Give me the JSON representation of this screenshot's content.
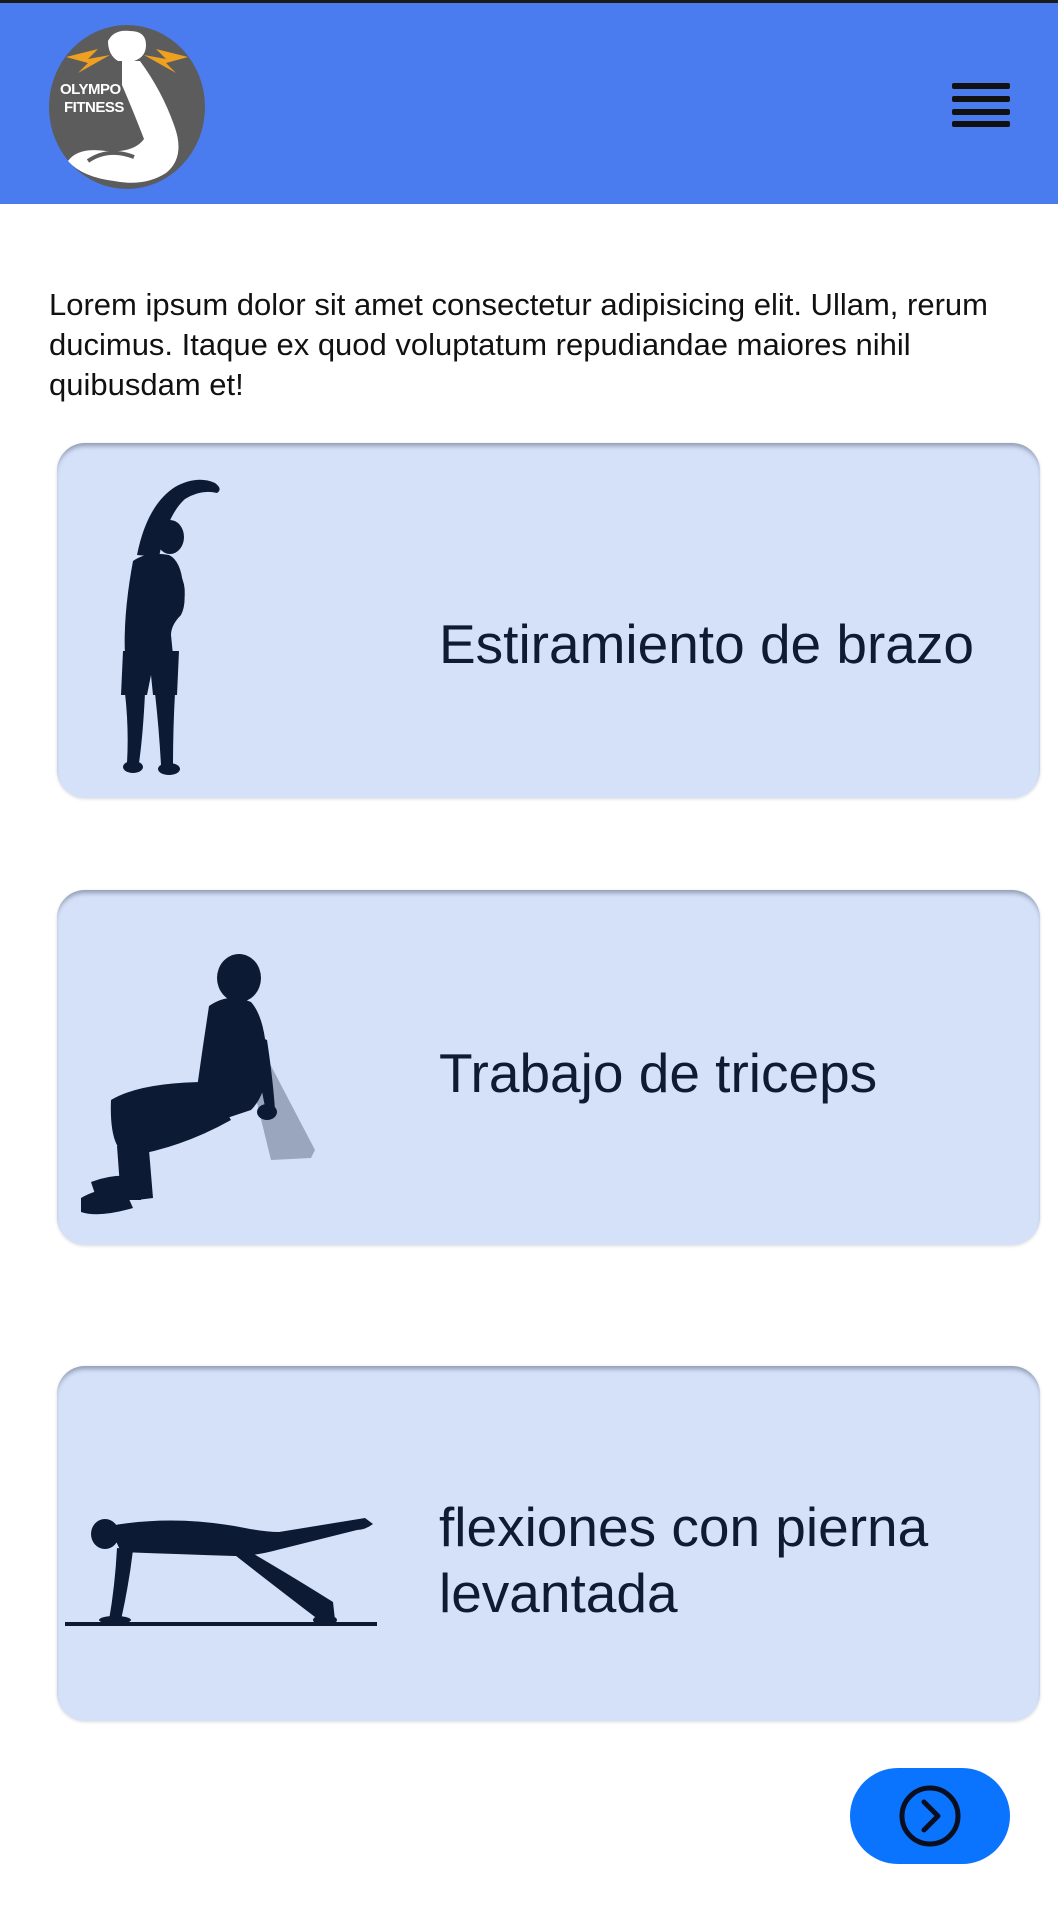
{
  "header": {
    "logo": {
      "line1": "OLYMPO",
      "line2": "FITNESS",
      "icon": "flexing-arm-lightning-logo"
    },
    "menu_icon": "hamburger-menu-icon"
  },
  "intro_text": "Lorem ipsum dolor sit amet consectetur adipisicing elit. Ullam, rerum ducimus. Itaque ex quod voluptatum repudiandae maiores nihil quibusdam et!",
  "exercises": [
    {
      "title": "Estiramiento de brazo",
      "icon": "side-stretch-silhouette"
    },
    {
      "title": "Trabajo de triceps",
      "icon": "triceps-dip-silhouette"
    },
    {
      "title": "flexiones con pierna levantada",
      "icon": "pushup-leg-raise-silhouette"
    }
  ],
  "next_button": {
    "icon": "chevron-right-circle-icon"
  },
  "colors": {
    "header": "#4a7bef",
    "card": "#d5e1f9",
    "card_text": "#0f1a33",
    "silhouette": "#0d1a33",
    "button": "#0a74ff"
  }
}
